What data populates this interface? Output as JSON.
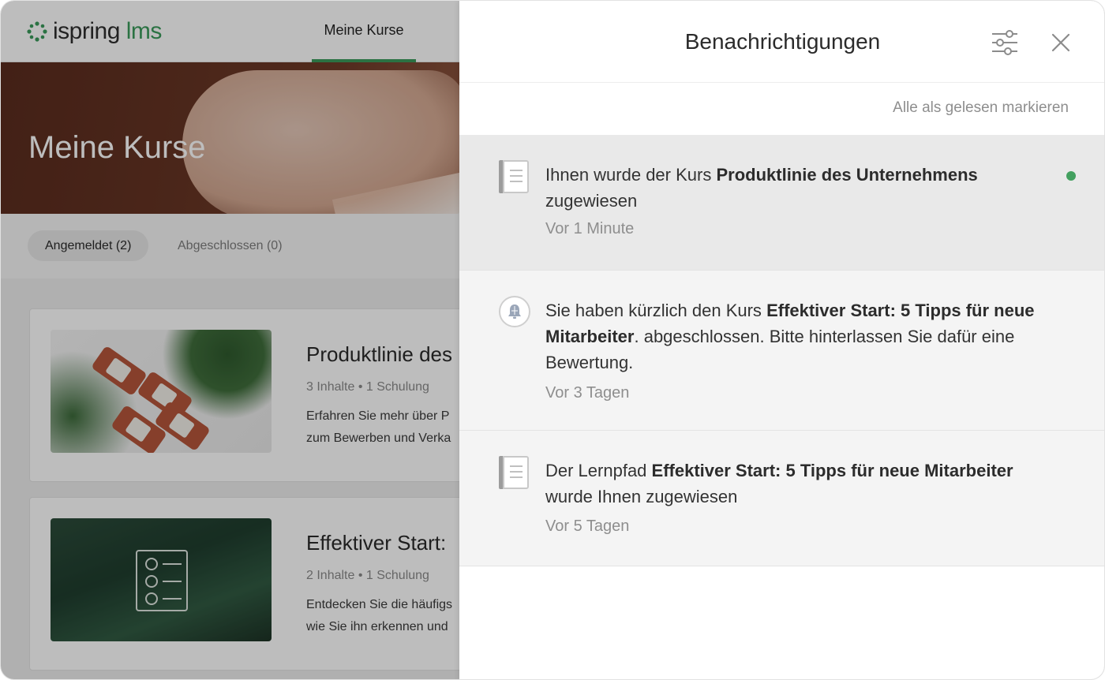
{
  "app": {
    "logo": {
      "brand": "ispring",
      "product": "lms",
      "brand_color": "#3a9a5b"
    },
    "nav": {
      "active_tab": "Meine Kurse"
    },
    "hero": {
      "title": "Meine Kurse"
    },
    "filters": {
      "enrolled": "Angemeldet (2)",
      "completed": "Abgeschlossen (0)"
    },
    "courses": [
      {
        "title": "Produktlinie des",
        "meta": "3 Inhalte • 1 Schulung",
        "desc_line1": "Erfahren Sie mehr über P",
        "desc_line2": "zum Bewerben und Verka"
      },
      {
        "title": "Effektiver Start:",
        "meta": "2 Inhalte • 1 Schulung",
        "desc_line1": "Entdecken Sie die häufigs",
        "desc_line2": "wie Sie ihn erkennen und"
      }
    ]
  },
  "panel": {
    "title": "Benachrichtigungen",
    "mark_all_read": "Alle als gelesen markieren",
    "notifications": [
      {
        "icon": "document-icon",
        "text_before": "Ihnen wurde der Kurs ",
        "text_bold": "Produktlinie des Unternehmens",
        "text_after": " zugewiesen",
        "time": "Vor 1 Minute",
        "unread": true
      },
      {
        "icon": "bell-icon",
        "text_before": "Sie haben kürzlich den Kurs ",
        "text_bold": "Effektiver Start: 5 Tipps für neue Mitarbeiter",
        "text_after": ". abgeschlossen. Bitte hinterlassen Sie dafür eine Bewertung.",
        "time": "Vor 3 Tagen",
        "unread": false
      },
      {
        "icon": "document-icon",
        "text_before": "Der Lernpfad ",
        "text_bold": "Effektiver Start: 5 Tipps für neue Mitarbeiter",
        "text_after": " wurde Ihnen zugewiesen",
        "time": "Vor 5 Tagen",
        "unread": false
      }
    ],
    "accent_color": "#43a05f"
  }
}
